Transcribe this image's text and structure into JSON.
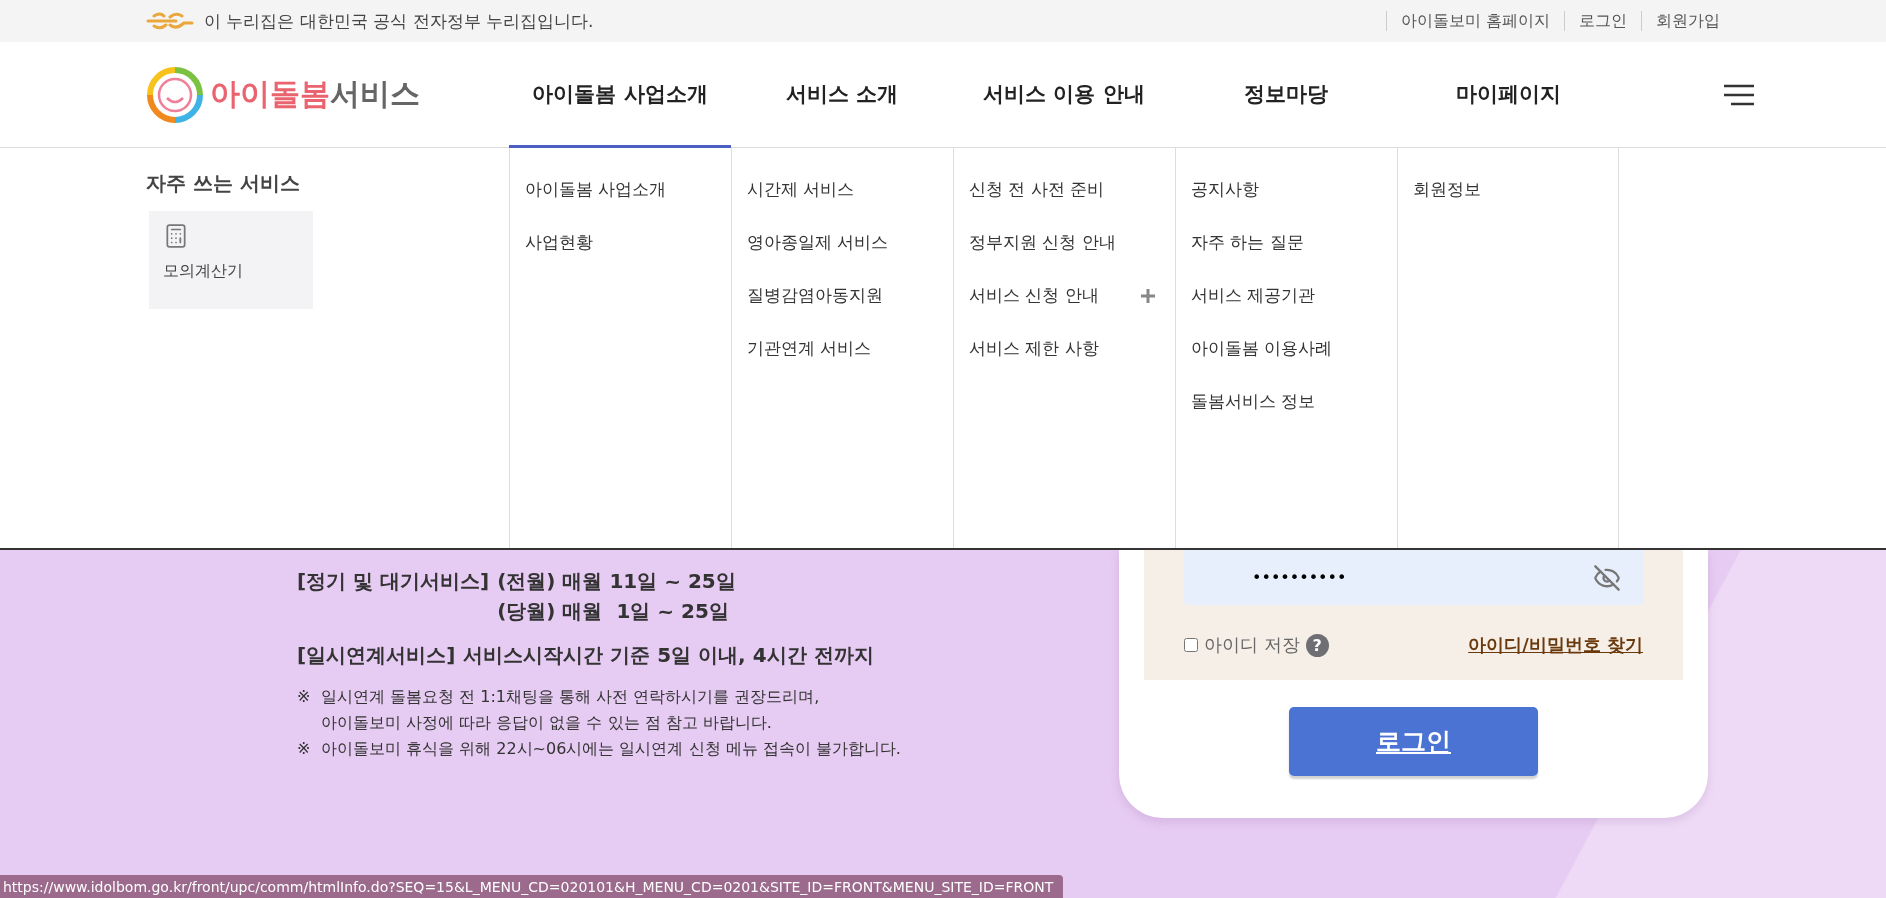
{
  "gov_bar": {
    "text": "이 누리집은 대한민국 공식 전자정부 누리집입니다.",
    "links": [
      "아이돌보미 홈페이지",
      "로그인",
      "회원가입"
    ]
  },
  "header": {
    "logo": {
      "accent": "아이돌봄",
      "rest": "서비스"
    },
    "nav": [
      {
        "label": "아이돌봄 사업소개",
        "selected": true
      },
      {
        "label": "서비스 소개",
        "selected": false
      },
      {
        "label": "서비스 이용 안내",
        "selected": false
      },
      {
        "label": "정보마당",
        "selected": false
      },
      {
        "label": "마이페이지",
        "selected": false
      }
    ]
  },
  "mega_menu": {
    "quick": {
      "title": "자주 쓰는 서비스",
      "items": [
        "모의계산기"
      ]
    },
    "columns": [
      {
        "items": [
          {
            "label": "아이돌봄 사업소개",
            "expandable": false
          },
          {
            "label": "사업현황",
            "expandable": false
          }
        ]
      },
      {
        "items": [
          {
            "label": "시간제 서비스",
            "expandable": false
          },
          {
            "label": "영아종일제 서비스",
            "expandable": false
          },
          {
            "label": "질병감염아동지원",
            "expandable": false
          },
          {
            "label": "기관연계 서비스",
            "expandable": false
          }
        ]
      },
      {
        "items": [
          {
            "label": "신청 전 사전 준비",
            "expandable": false
          },
          {
            "label": "정부지원 신청 안내",
            "expandable": false
          },
          {
            "label": "서비스 신청 안내",
            "expandable": true
          },
          {
            "label": "서비스 제한 사항",
            "expandable": false
          }
        ]
      },
      {
        "items": [
          {
            "label": "공지사항",
            "expandable": false
          },
          {
            "label": "자주 하는 질문",
            "expandable": false
          },
          {
            "label": "서비스 제공기관",
            "expandable": false
          },
          {
            "label": "아이돌봄 이용사례",
            "expandable": false
          },
          {
            "label": "돌봄서비스 정보",
            "expandable": false
          }
        ]
      },
      {
        "items": [
          {
            "label": "회원정보",
            "expandable": false
          }
        ]
      }
    ]
  },
  "notice": {
    "schedule": [
      {
        "label": "[정기 및 대기서비스]",
        "lines": [
          "(전월) 매월 11일 ~ 25일",
          "(당월) 매월  1일 ~ 25일"
        ]
      },
      {
        "label": "[일시연계서비스]",
        "lines": [
          "서비스시작시간 기준 5일 이내, 4시간 전까지"
        ]
      }
    ],
    "notes": [
      {
        "mark": "※",
        "lines": [
          "일시연계 돌봄요청 전 1:1채팅을 통해 사전 연락하시기를 권장드리며,",
          "아이돌보미 사정에 따라 응답이 없을 수 있는 점 참고 바랍니다."
        ]
      },
      {
        "mark": "※",
        "lines": [
          "아이돌보미 휴식을 위해 22시~06시에는 일시연계 신청 메뉴 접속이 불가합니다."
        ]
      }
    ]
  },
  "login": {
    "password": "••••••••••",
    "save_id": {
      "label": "아이디 저장",
      "checked": false,
      "help": "?"
    },
    "find_link": "아이디/비밀번호 찾기",
    "submit": "로그인"
  },
  "status_bar": "https://www.idolbom.go.kr/front/upc/comm/htmlInfo.do?SEQ=15&L_MENU_CD=020101&H_MENU_CD=0201&SITE_ID=FRONT&MENU_SITE_ID=FRONT"
}
